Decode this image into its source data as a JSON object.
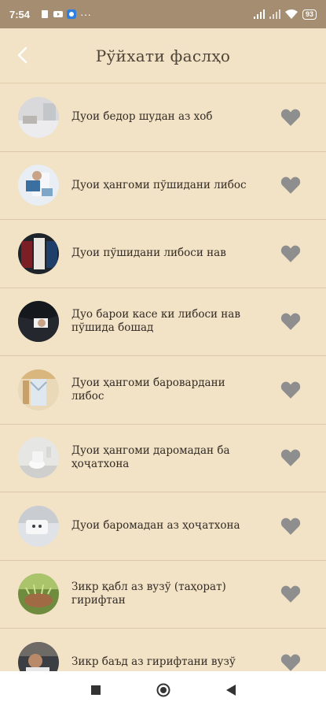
{
  "status_bar": {
    "time": "7:54",
    "battery": "93"
  },
  "header": {
    "title": "Рўйхати фаслҳо"
  },
  "items": [
    {
      "label": "Дуои бедор шудан аз хоб"
    },
    {
      "label": "Дуои ҳангоми пўшидани либос"
    },
    {
      "label": "Дуои пўшидани либоси нав"
    },
    {
      "label": "Дуо барои касе ки либоси нав пўшида бошад"
    },
    {
      "label": "Дуои ҳангоми баровардани либос"
    },
    {
      "label": "Дуои ҳангоми даромадан ба ҳоҷатхона"
    },
    {
      "label": "Дуои баромадан аз ҳоҷатхона"
    },
    {
      "label": "Зикр қабл аз вузў (таҳорат) гирифтан"
    },
    {
      "label": "Зикр баъд аз гирифтани вузў"
    }
  ],
  "colors": {
    "background": "#f2e2c6",
    "status_bar": "#a58d72",
    "heart": "#8e8e8e"
  }
}
